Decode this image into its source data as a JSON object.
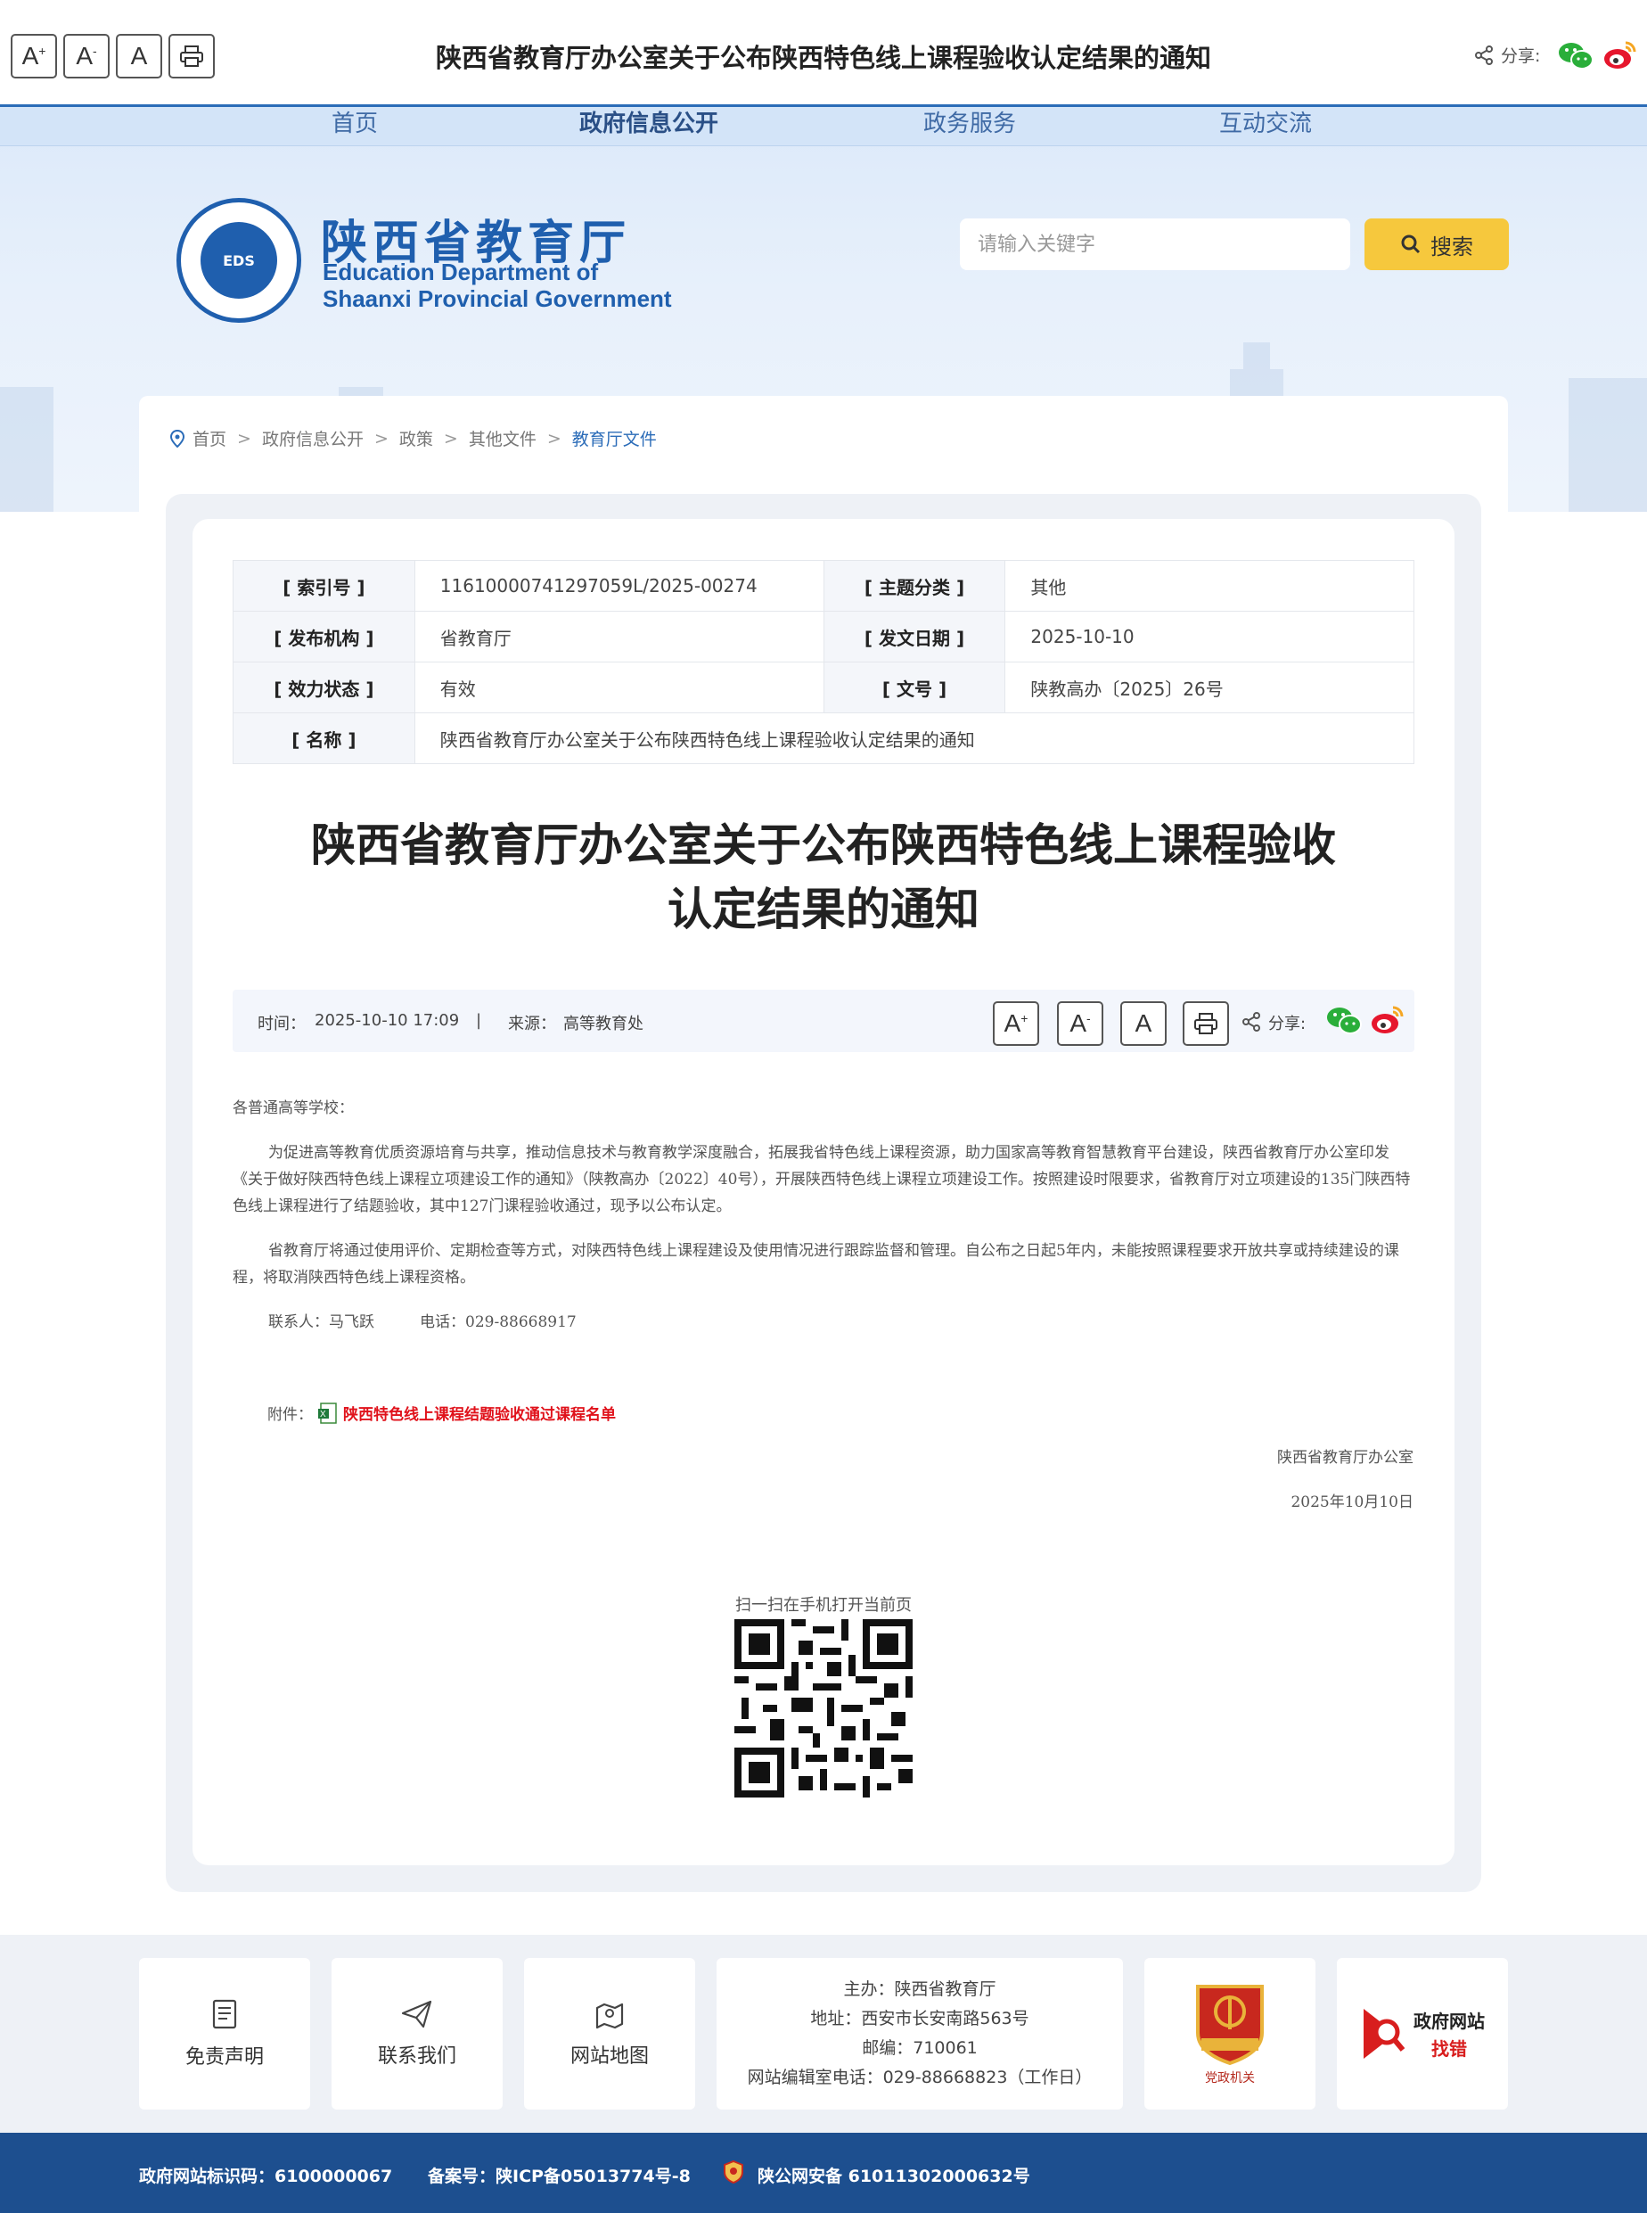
{
  "topbar": {
    "font_increase": "A",
    "font_decrease": "A",
    "font_reset": "A",
    "title": "陕西省教育厅办公室关于公布陕西特色线上课程验收认定结果的通知",
    "share_label": "分享:"
  },
  "nav": {
    "items": [
      {
        "label": "首页"
      },
      {
        "label": "政府信息公开"
      },
      {
        "label": "政务服务"
      },
      {
        "label": "互动交流"
      }
    ]
  },
  "logo": {
    "badge": "EDS",
    "name_cn": "陕西省教育厅",
    "name_en_1": "Education Department of",
    "name_en_2": "Shaanxi Provincial Government"
  },
  "search": {
    "placeholder": "请输入关键字",
    "button": "搜索"
  },
  "breadcrumb": [
    "首页",
    "政府信息公开",
    "政策",
    "其他文件",
    "教育厅文件"
  ],
  "meta": {
    "index_label": "[ 索引号 ]",
    "index_value": "11610000741297059L/2025-00274",
    "topic_label": "[ 主题分类 ]",
    "topic_value": "其他",
    "org_label": "[ 发布机构 ]",
    "org_value": "省教育厅",
    "date_label": "[ 发文日期 ]",
    "date_value": "2025-10-10",
    "status_label": "[ 效力状态 ]",
    "status_value": "有效",
    "docno_label": "[ 文号 ]",
    "docno_value": "陕教高办〔2025〕26号",
    "name_label": "[ 名称 ]",
    "name_value": "陕西省教育厅办公室关于公布陕西特色线上课程验收认定结果的通知"
  },
  "article": {
    "title_line1": "陕西省教育厅办公室关于公布陕西特色线上课程验收",
    "title_line2": "认定结果的通知",
    "time_label": "时间：",
    "time_value": "2025-10-10 17:09",
    "divider": "|",
    "source_label": "来源：",
    "source_value": "高等教育处",
    "share_label": "分享:",
    "salutation": "各普通高等学校：",
    "para1": "为促进高等教育优质资源培育与共享，推动信息技术与教育教学深度融合，拓展我省特色线上课程资源，助力国家高等教育智慧教育平台建设，陕西省教育厅办公室印发《关于做好陕西特色线上课程立项建设工作的通知》（陕教高办〔2022〕40号），开展陕西特色线上课程立项建设工作。按照建设时限要求，省教育厅对立项建设的135门陕西特色线上课程进行了结题验收，其中127门课程验收通过，现予以公布认定。",
    "para2": "省教育厅将通过使用评价、定期检查等方式，对陕西特色线上课程建设及使用情况进行跟踪监督和管理。自公布之日起5年内，未能按照课程要求开放共享或持续建设的课程，将取消陕西特色线上课程资格。",
    "contact": "联系人：马飞跃　　　电话：029-88668917",
    "attach_label": "附件：",
    "attach_link": "陕西特色线上课程结题验收通过课程名单",
    "sign_org": "陕西省教育厅办公室",
    "sign_date": "2025年10月10日",
    "qr_caption": "扫一扫在手机打开当前页"
  },
  "footer": {
    "disclaimer": "免责声明",
    "contact": "联系我们",
    "sitemap": "网站地图",
    "info": {
      "host": "主办：陕西省教育厅",
      "address": "地址：西安市长安南路563号",
      "zip": "邮编：710061",
      "phone": "网站编辑室电话：029-88668823（工作日）"
    },
    "dangzheng_badge": "党政机关",
    "gov_error_line1": "政府网站",
    "gov_error_line2": "找错",
    "site_id": "政府网站标识码：6100000067",
    "icp": "备案号：陕ICP备05013774号-8",
    "police": "陕公网安备 61011302000632号"
  },
  "colors": {
    "brand_blue": "#1f5fae",
    "search_yellow": "#f6c83d",
    "footer_blue": "#1d4f8f",
    "link_red": "#e0121b",
    "valid_green": "#2a9a2a"
  }
}
